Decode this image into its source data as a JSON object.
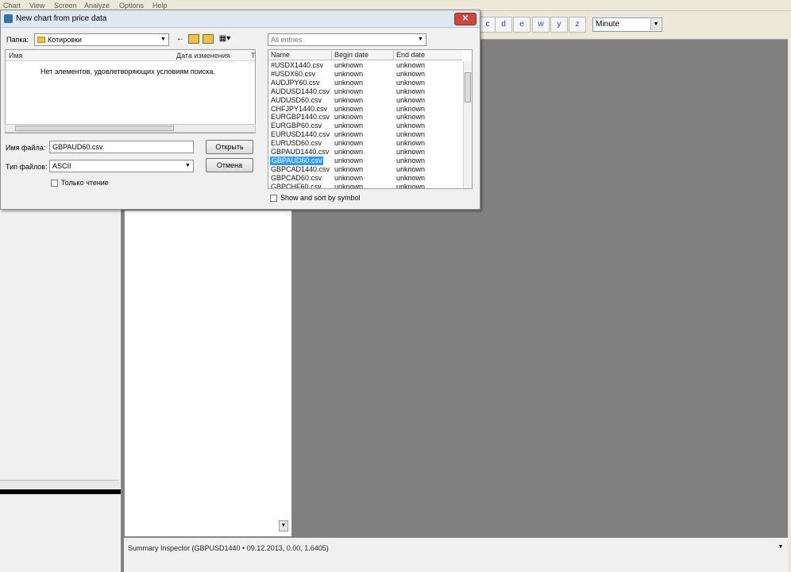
{
  "menu": [
    "Chart",
    "View",
    "Screen",
    "Analyze",
    "Options",
    "Help"
  ],
  "timeframe_buttons": [
    "c",
    "d",
    "e",
    "w",
    "y",
    "z"
  ],
  "timeframe_select": "Minute",
  "dialog": {
    "title": "New chart from price data",
    "close_label": "✕",
    "folder_label": "Папка:",
    "folder_value": "Котировки",
    "list_columns": [
      "Имя",
      "Дата изменения",
      "Т"
    ],
    "empty_message": "Нет элементов, удовлетворяющих условиям поиска.",
    "filename_label": "Имя файла:",
    "filename_value": "GBPAUD60.csv",
    "filetype_label": "Тип файлов:",
    "filetype_value": "ASCII",
    "open_button": "Открыть",
    "cancel_button": "Отмена",
    "readonly_label": "Только чтение",
    "entries_filter": "All entries",
    "entries_columns": [
      "Name",
      "Begin date",
      "End date"
    ],
    "entries": [
      {
        "name": "#USDX1440.csv",
        "begin": "unknown",
        "end": "unknown"
      },
      {
        "name": "#USDX60.csv",
        "begin": "unknown",
        "end": "unknown"
      },
      {
        "name": "AUDJPY60.csv",
        "begin": "unknown",
        "end": "unknown"
      },
      {
        "name": "AUDUSD1440.csv",
        "begin": "unknown",
        "end": "unknown"
      },
      {
        "name": "AUDUSD60.csv",
        "begin": "unknown",
        "end": "unknown"
      },
      {
        "name": "CHFJPY1440.csv",
        "begin": "unknown",
        "end": "unknown"
      },
      {
        "name": "EURGBP1440.csv",
        "begin": "unknown",
        "end": "unknown"
      },
      {
        "name": "EURGBP60.csv",
        "begin": "unknown",
        "end": "unknown"
      },
      {
        "name": "EURUSD1440.csv",
        "begin": "unknown",
        "end": "unknown"
      },
      {
        "name": "EURUSD60.csv",
        "begin": "unknown",
        "end": "unknown"
      },
      {
        "name": "GBPAUD1440.csv",
        "begin": "unknown",
        "end": "unknown"
      },
      {
        "name": "GBPAUD60.csv",
        "begin": "unknown",
        "end": "unknown",
        "selected": true
      },
      {
        "name": "GBPCAD1440.csv",
        "begin": "unknown",
        "end": "unknown"
      },
      {
        "name": "GBPCAD60.csv",
        "begin": "unknown",
        "end": "unknown"
      },
      {
        "name": "GBPCHF60.csv",
        "begin": "unknown",
        "end": "unknown"
      }
    ],
    "show_sort_label": "Show and sort by symbol"
  },
  "summary_text": "Summary Inspector (GBPUSD1440 • 09.12.2013, 0.00, 1.6405)",
  "colors": {
    "selection": "#3399ff",
    "chart_background": "#808080",
    "close_button": "#c94a3e"
  }
}
